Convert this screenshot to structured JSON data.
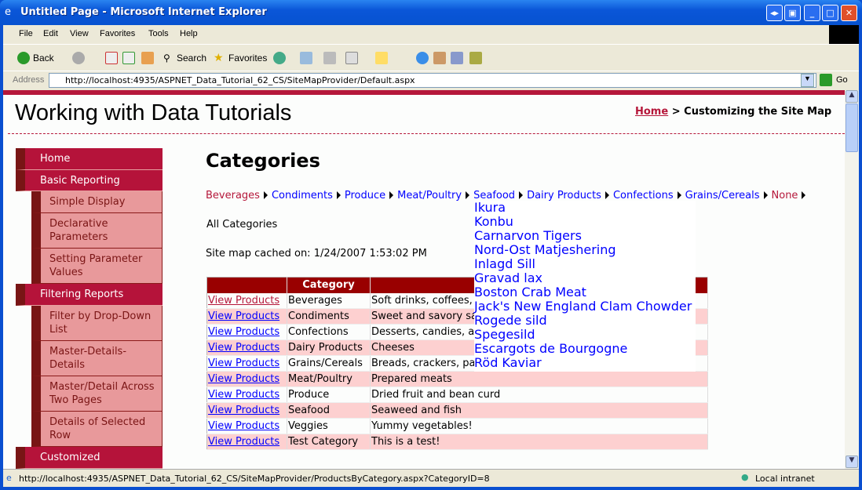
{
  "window": {
    "title": "Untitled Page - Microsoft Internet Explorer"
  },
  "menubar": [
    "File",
    "Edit",
    "View",
    "Favorites",
    "Tools",
    "Help"
  ],
  "toolbar": {
    "back": "Back",
    "search": "Search",
    "favorites": "Favorites"
  },
  "address": {
    "label": "Address",
    "url": "http://localhost:4935/ASPNET_Data_Tutorial_62_CS/SiteMapProvider/Default.aspx",
    "go": "Go"
  },
  "header": {
    "site_title": "Working with Data Tutorials",
    "crumb_home": "Home",
    "crumb_sep": ">",
    "crumb_current": "Customizing the Site Map"
  },
  "sidebar": [
    {
      "label": "Home",
      "level": "top"
    },
    {
      "label": "Basic Reporting",
      "level": "top"
    },
    {
      "label": "Simple Display",
      "level": "sub"
    },
    {
      "label": "Declarative Parameters",
      "level": "sub"
    },
    {
      "label": "Setting Parameter Values",
      "level": "sub"
    },
    {
      "label": "Filtering Reports",
      "level": "top"
    },
    {
      "label": "Filter by Drop-Down List",
      "level": "sub"
    },
    {
      "label": "Master-Details-Details",
      "level": "sub"
    },
    {
      "label": "Master/Detail Across Two Pages",
      "level": "sub"
    },
    {
      "label": "Details of Selected Row",
      "level": "sub"
    },
    {
      "label": "Customized",
      "level": "top"
    }
  ],
  "main": {
    "heading": "Categories",
    "category_menu": [
      {
        "label": "Beverages",
        "selected": true
      },
      {
        "label": "Condiments"
      },
      {
        "label": "Produce"
      },
      {
        "label": "Meat/Poultry"
      },
      {
        "label": "Seafood"
      },
      {
        "label": "Dairy Products"
      },
      {
        "label": "Confections"
      },
      {
        "label": "Grains/Cereals"
      },
      {
        "label": "None",
        "selected": true
      }
    ],
    "all_categories": "All Categories",
    "cached": "Site map cached on: 1/24/2007 1:53:02 PM",
    "popup_items": [
      "Ikura",
      "Konbu",
      "Carnarvon Tigers",
      "Nord-Ost Matjeshering",
      "Inlagd Sill",
      "Gravad lax",
      "Boston Crab Meat",
      "Jack's New England Clam Chowder",
      "Rogede sild",
      "Spegesild",
      "Escargots de Bourgogne",
      "Röd Kaviar"
    ],
    "table": {
      "columns": [
        "",
        "Category",
        ""
      ],
      "link_label": "View Products",
      "rows": [
        {
          "category": "Beverages",
          "description": "Soft drinks, coffees, teas, beers, and ales",
          "visited": true
        },
        {
          "category": "Condiments",
          "description": "Sweet and savory sauces, relishes, spreads, and seasonings"
        },
        {
          "category": "Confections",
          "description": "Desserts, candies, and sweet breads"
        },
        {
          "category": "Dairy Products",
          "description": "Cheeses"
        },
        {
          "category": "Grains/Cereals",
          "description": "Breads, crackers, pasta, and cereal"
        },
        {
          "category": "Meat/Poultry",
          "description": "Prepared meats"
        },
        {
          "category": "Produce",
          "description": "Dried fruit and bean curd"
        },
        {
          "category": "Seafood",
          "description": "Seaweed and fish"
        },
        {
          "category": "Veggies",
          "description": "Yummy vegetables!"
        },
        {
          "category": "Test Category",
          "description": "This is a test!"
        }
      ]
    }
  },
  "status": {
    "text": "http://localhost:4935/ASPNET_Data_Tutorial_62_CS/SiteMapProvider/ProductsByCategory.aspx?CategoryID=8",
    "zone": "Local intranet"
  },
  "colors": {
    "accent": "#b5173a",
    "header_bg": "#990000",
    "alt_row": "#fdd0d0",
    "sub_nav": "#e8999b"
  }
}
